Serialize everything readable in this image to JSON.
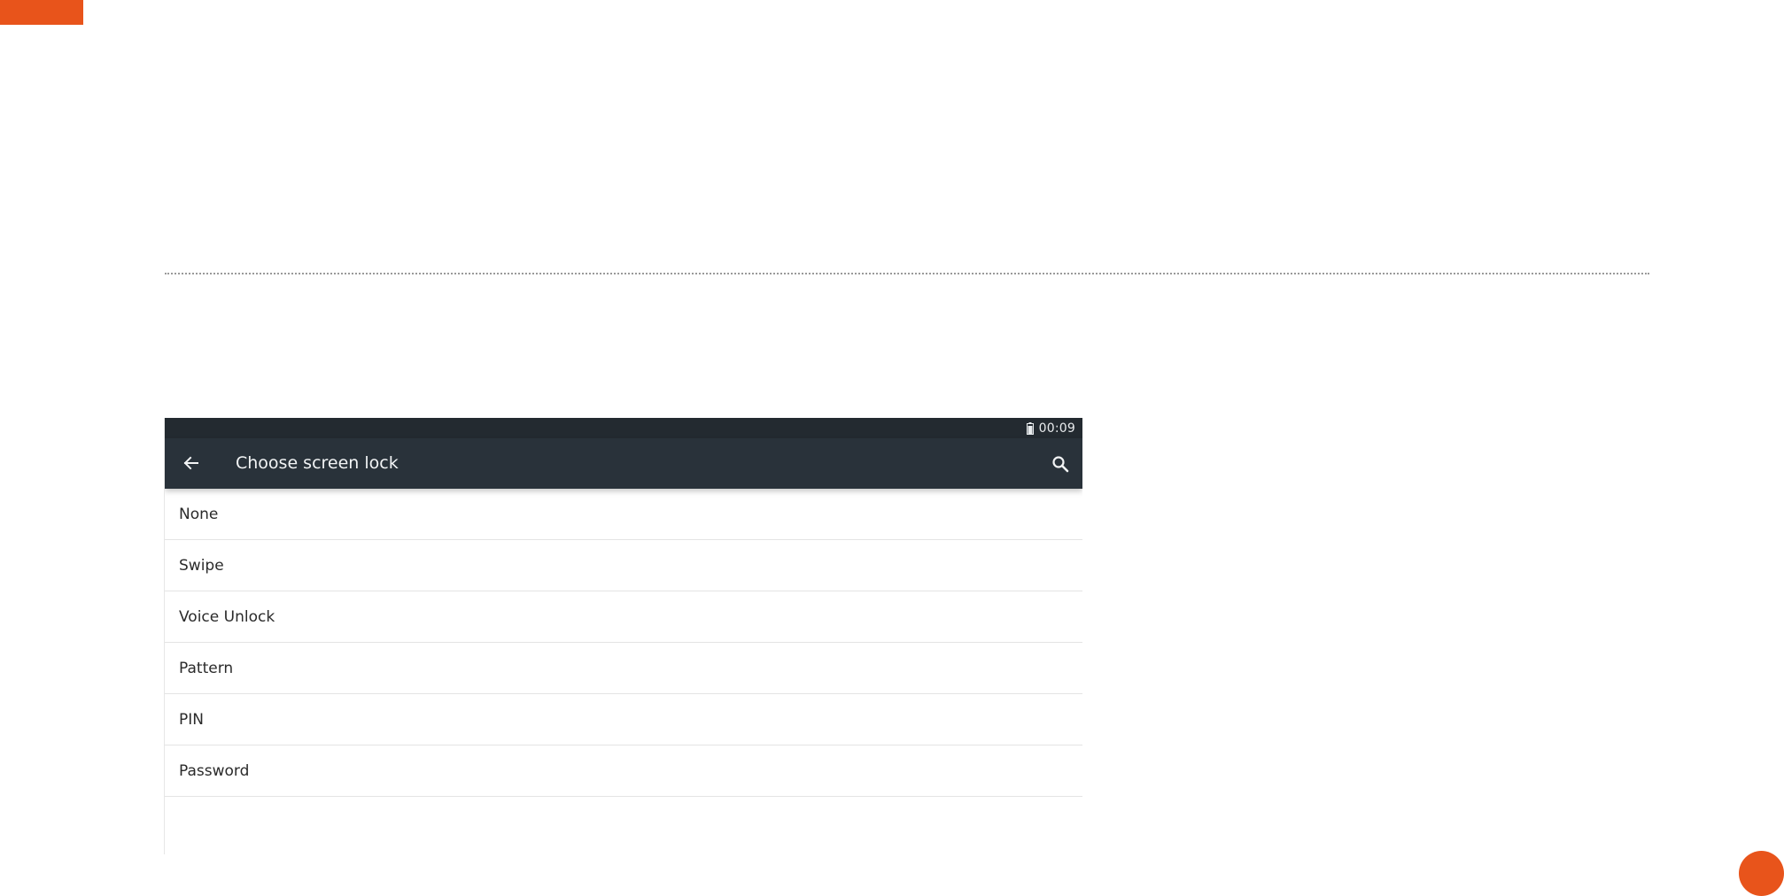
{
  "status_bar": {
    "time": "00:09",
    "battery_icon": "battery-icon"
  },
  "app_bar": {
    "title": "Choose screen lock",
    "back_icon": "arrow-left-icon",
    "search_icon": "search-icon",
    "background_color": "#29323a"
  },
  "lock_options": [
    {
      "label": "None"
    },
    {
      "label": "Swipe"
    },
    {
      "label": "Voice Unlock"
    },
    {
      "label": "Pattern"
    },
    {
      "label": "PIN"
    },
    {
      "label": "Password"
    }
  ],
  "slide": {
    "accent_color": "#e8541b"
  }
}
